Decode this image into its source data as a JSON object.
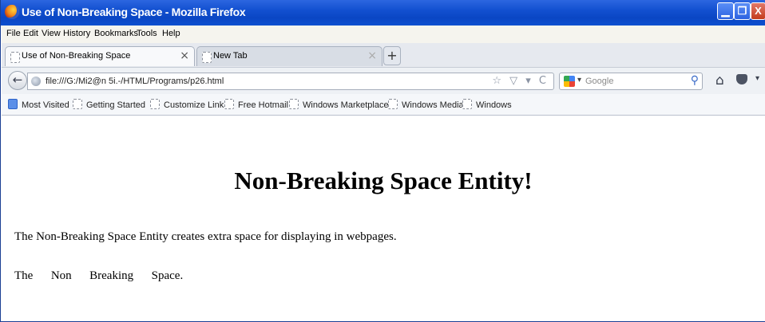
{
  "window": {
    "title": "Use of Non-Breaking Space - Mozilla Firefox",
    "buttons": {
      "minimize": "▁",
      "maximize": "❐",
      "close": "X"
    }
  },
  "menubar": [
    "File",
    "Edit",
    "View",
    "History",
    "Bookmarks",
    "Tools",
    "Help"
  ],
  "tabs": [
    {
      "label": "Use of Non-Breaking Space",
      "close": "×",
      "active": true
    },
    {
      "label": "New Tab",
      "close": "×",
      "active": false
    }
  ],
  "new_tab": "+",
  "navbar": {
    "back": "←",
    "url": "file:///G:/Mi2@n 5i.-/HTML/Programs/p26.html",
    "url_icons": "☆ ▽ ▾ C",
    "search_placeholder": "Google",
    "search_caret": "▾",
    "search_go": "⚲",
    "home": "⌂",
    "menu_more": "▾"
  },
  "bookmarks": [
    "Most Visited",
    "Getting Started",
    "Customize Links",
    "Free Hotmail",
    "Windows Marketplace",
    "Windows Media",
    "Windows"
  ],
  "page": {
    "heading": "Non-Breaking Space Entity!",
    "paragraph1": "The Non-Breaking Space Entity creates extra space for displaying in webpages.",
    "paragraph2": "The      Non      Breaking      Space."
  },
  "colors": {
    "titlebar": "#0d4fcf",
    "tab_active": "#f8f9fb",
    "background": "#ffffff"
  }
}
